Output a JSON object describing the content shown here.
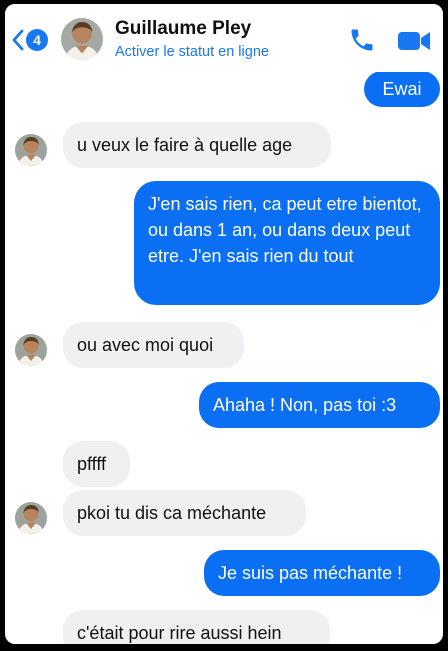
{
  "header": {
    "back_count": "4",
    "contact_name": "Guillaume Pley",
    "status": "Activer le statut en ligne"
  },
  "colors": {
    "accent": "#1877f2",
    "outgoing_bubble": "#0a6ff2",
    "incoming_bubble": "#f0f0f2"
  },
  "icons": {
    "back": "chevron-left-icon",
    "call": "phone-icon",
    "video": "video-camera-icon"
  },
  "messages": [
    {
      "direction": "out",
      "text": "Ewai"
    },
    {
      "direction": "in",
      "text": "u veux le faire à quelle age"
    },
    {
      "direction": "out",
      "text": "J'en sais rien, ca peut etre bientot, ou dans 1 an, ou dans deux peut etre. J'en sais rien du tout"
    },
    {
      "direction": "in",
      "text": "ou avec moi quoi"
    },
    {
      "direction": "out",
      "text": "Ahaha ! Non, pas toi :3"
    },
    {
      "direction": "in",
      "text": "pffff"
    },
    {
      "direction": "in",
      "text": "pkoi tu dis ca méchante"
    },
    {
      "direction": "out",
      "text": "Je suis pas méchante !"
    },
    {
      "direction": "in",
      "text": "c'était pour rire aussi hein"
    }
  ]
}
